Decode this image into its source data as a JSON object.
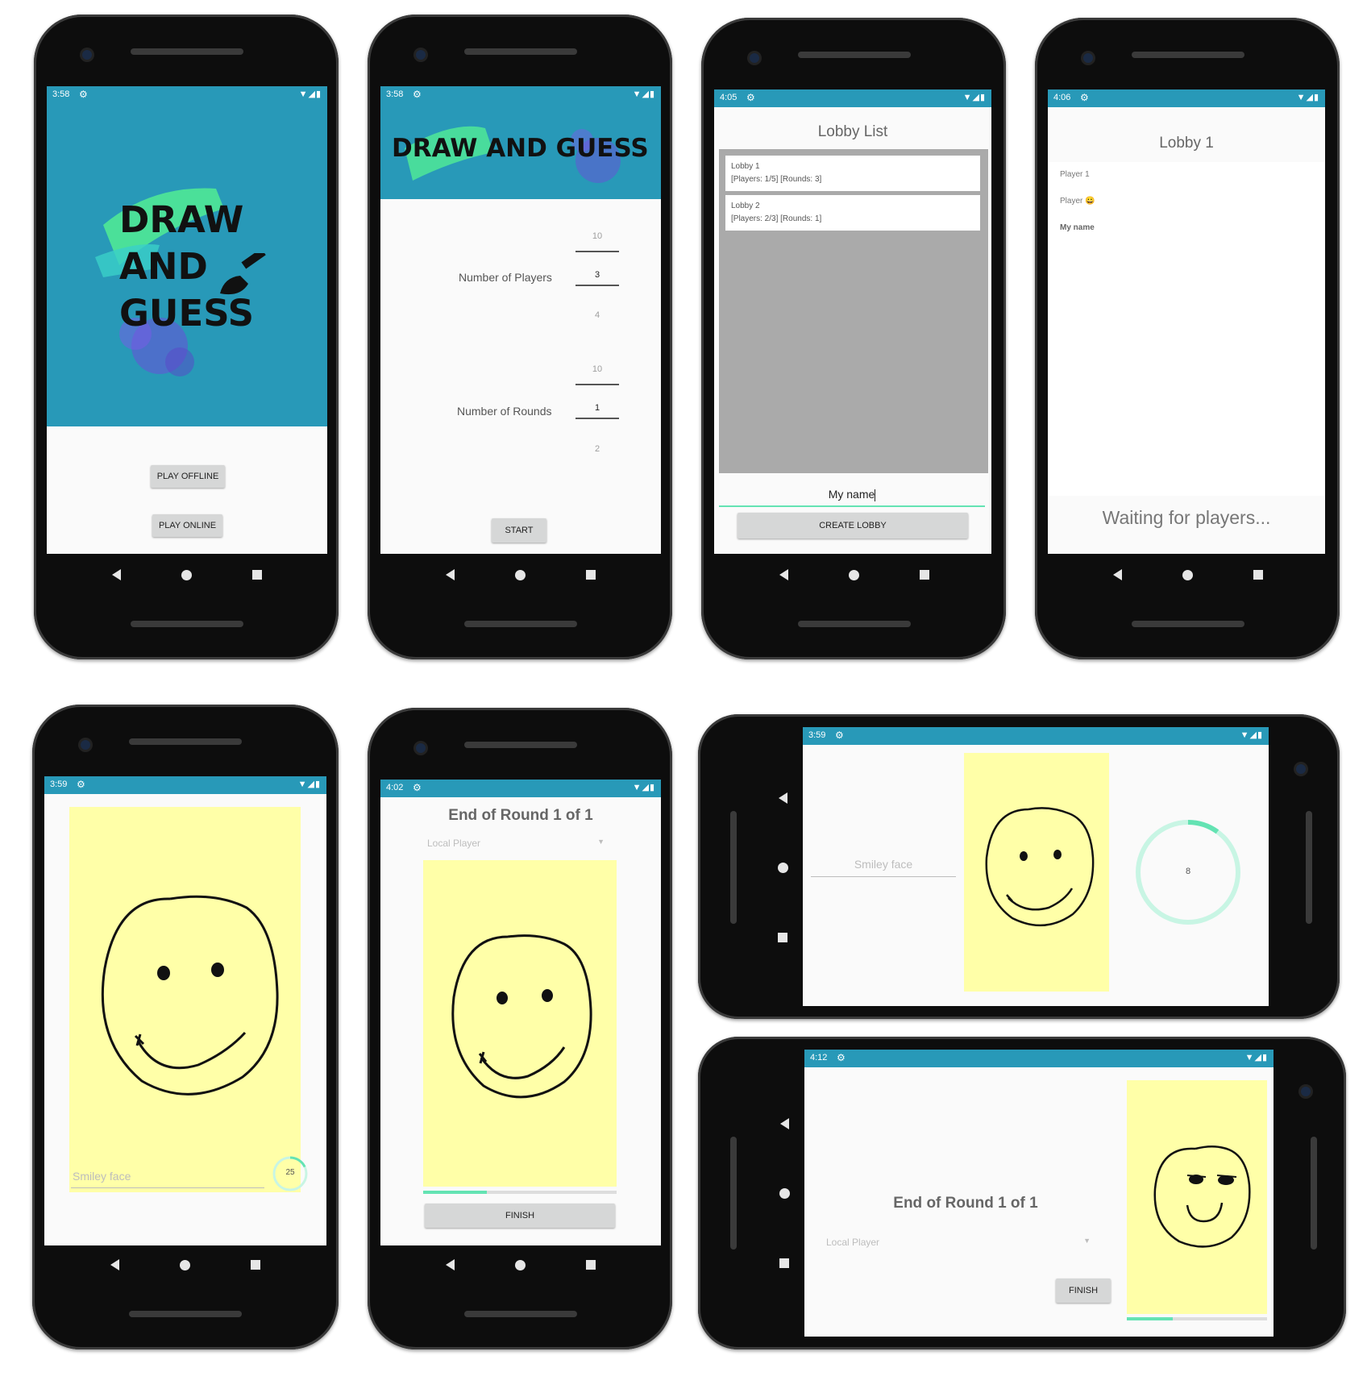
{
  "splash": {
    "status_time": "3:58",
    "logo_lines": [
      "DRAW",
      "AND",
      "GUESS"
    ],
    "play_offline": "PLAY OFFLINE",
    "play_online": "PLAY ONLINE"
  },
  "settings": {
    "status_time": "3:58",
    "banner_title": "DRAW AND GUESS",
    "players_label": "Number of Players",
    "players_above": "10",
    "players_value": "3",
    "players_below": "4",
    "rounds_label": "Number of Rounds",
    "rounds_above": "10",
    "rounds_value": "1",
    "rounds_below": "2",
    "start": "START"
  },
  "lobby_list": {
    "status_time": "4:05",
    "title": "Lobby List",
    "lobbies": [
      {
        "name": "Lobby 1",
        "info": "[Players: 1/5] [Rounds: 3]"
      },
      {
        "name": "Lobby 2",
        "info": "[Players: 2/3] [Rounds: 1]"
      }
    ],
    "name_input": "My name",
    "create": "CREATE LOBBY"
  },
  "lobby": {
    "status_time": "4:06",
    "title": "Lobby 1",
    "players": [
      "Player 1",
      "Player 😀",
      "My name"
    ],
    "waiting": "Waiting for players..."
  },
  "drawing": {
    "status_time": "3:59",
    "guess_placeholder": "Smiley face",
    "timer": "25",
    "timer_progress": 0.18
  },
  "round_end": {
    "status_time": "4:02",
    "title": "End of Round 1 of 1",
    "player_select": "Local Player",
    "progress": 0.33,
    "finish": "FINISH"
  },
  "landscape_drawing": {
    "status_time": "3:59",
    "guess_placeholder": "Smiley face",
    "timer": "8",
    "timer_progress": 0.1
  },
  "landscape_round_end": {
    "status_time": "4:12",
    "title": "End of Round 1 of 1",
    "player_select": "Local Player",
    "finish": "FINISH",
    "progress": 0.33
  },
  "colors": {
    "status_bar": "#2899b8",
    "canvas": "#ffffa8",
    "accent": "#64e3b3"
  },
  "icons": [
    "settings-gear-icon",
    "wifi-icon",
    "signal-icon",
    "battery-icon",
    "nav-back-icon",
    "nav-home-icon",
    "nav-recent-icon",
    "paintbrush-icon",
    "dropdown-arrow-icon"
  ]
}
